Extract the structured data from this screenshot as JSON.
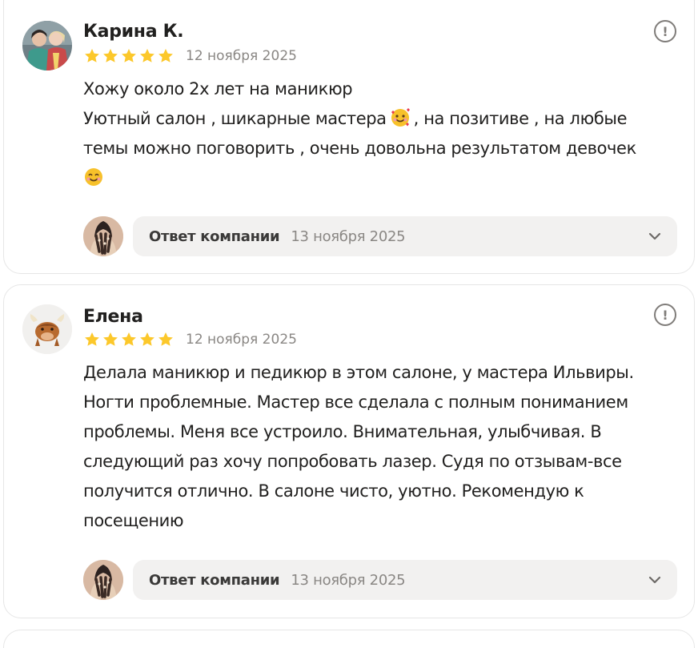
{
  "reviews": [
    {
      "author": "Карина К.",
      "rating": 5,
      "date": "12 ноября 2025",
      "text_lines": [
        "Хожу около 2х лет на маникюр",
        "Уютный салон , шикарные мастера",
        ", на позитиве , на любые",
        "темы можно поговорить , очень довольна результатом девочек"
      ],
      "emojis": [
        "smiling-face-with-hearts",
        "smiling-face-with-smiling-eyes"
      ],
      "company_reply": {
        "label": "Ответ компании",
        "date": "13 ноября 2025"
      }
    },
    {
      "author": "Елена",
      "rating": 5,
      "date": "12 ноября 2025",
      "text_lines": [
        "Делала маникюр и педикюр в этом салоне, у мастера Ильвиры.",
        "Ногти проблемные. Мастер все сделала с полным пониманием",
        "проблемы. Меня все устроило. Внимательная, улыбчивая. В",
        "следующий раз хочу попробовать лазер. Судя по отзывам-все",
        "получится отлично. В салоне чисто, уютно. Рекомендую к",
        "посещению"
      ],
      "company_reply": {
        "label": "Ответ компании",
        "date": "13 ноября 2025"
      }
    }
  ],
  "colors": {
    "star": "#fcc82b",
    "text": "#21201f",
    "muted": "#8a8784",
    "reply_bg": "#f2f1f0",
    "card_border": "#e6e6e6"
  },
  "icons": {
    "report": "exclamation-circle-icon",
    "expand": "chevron-down-icon",
    "star": "star-icon"
  }
}
